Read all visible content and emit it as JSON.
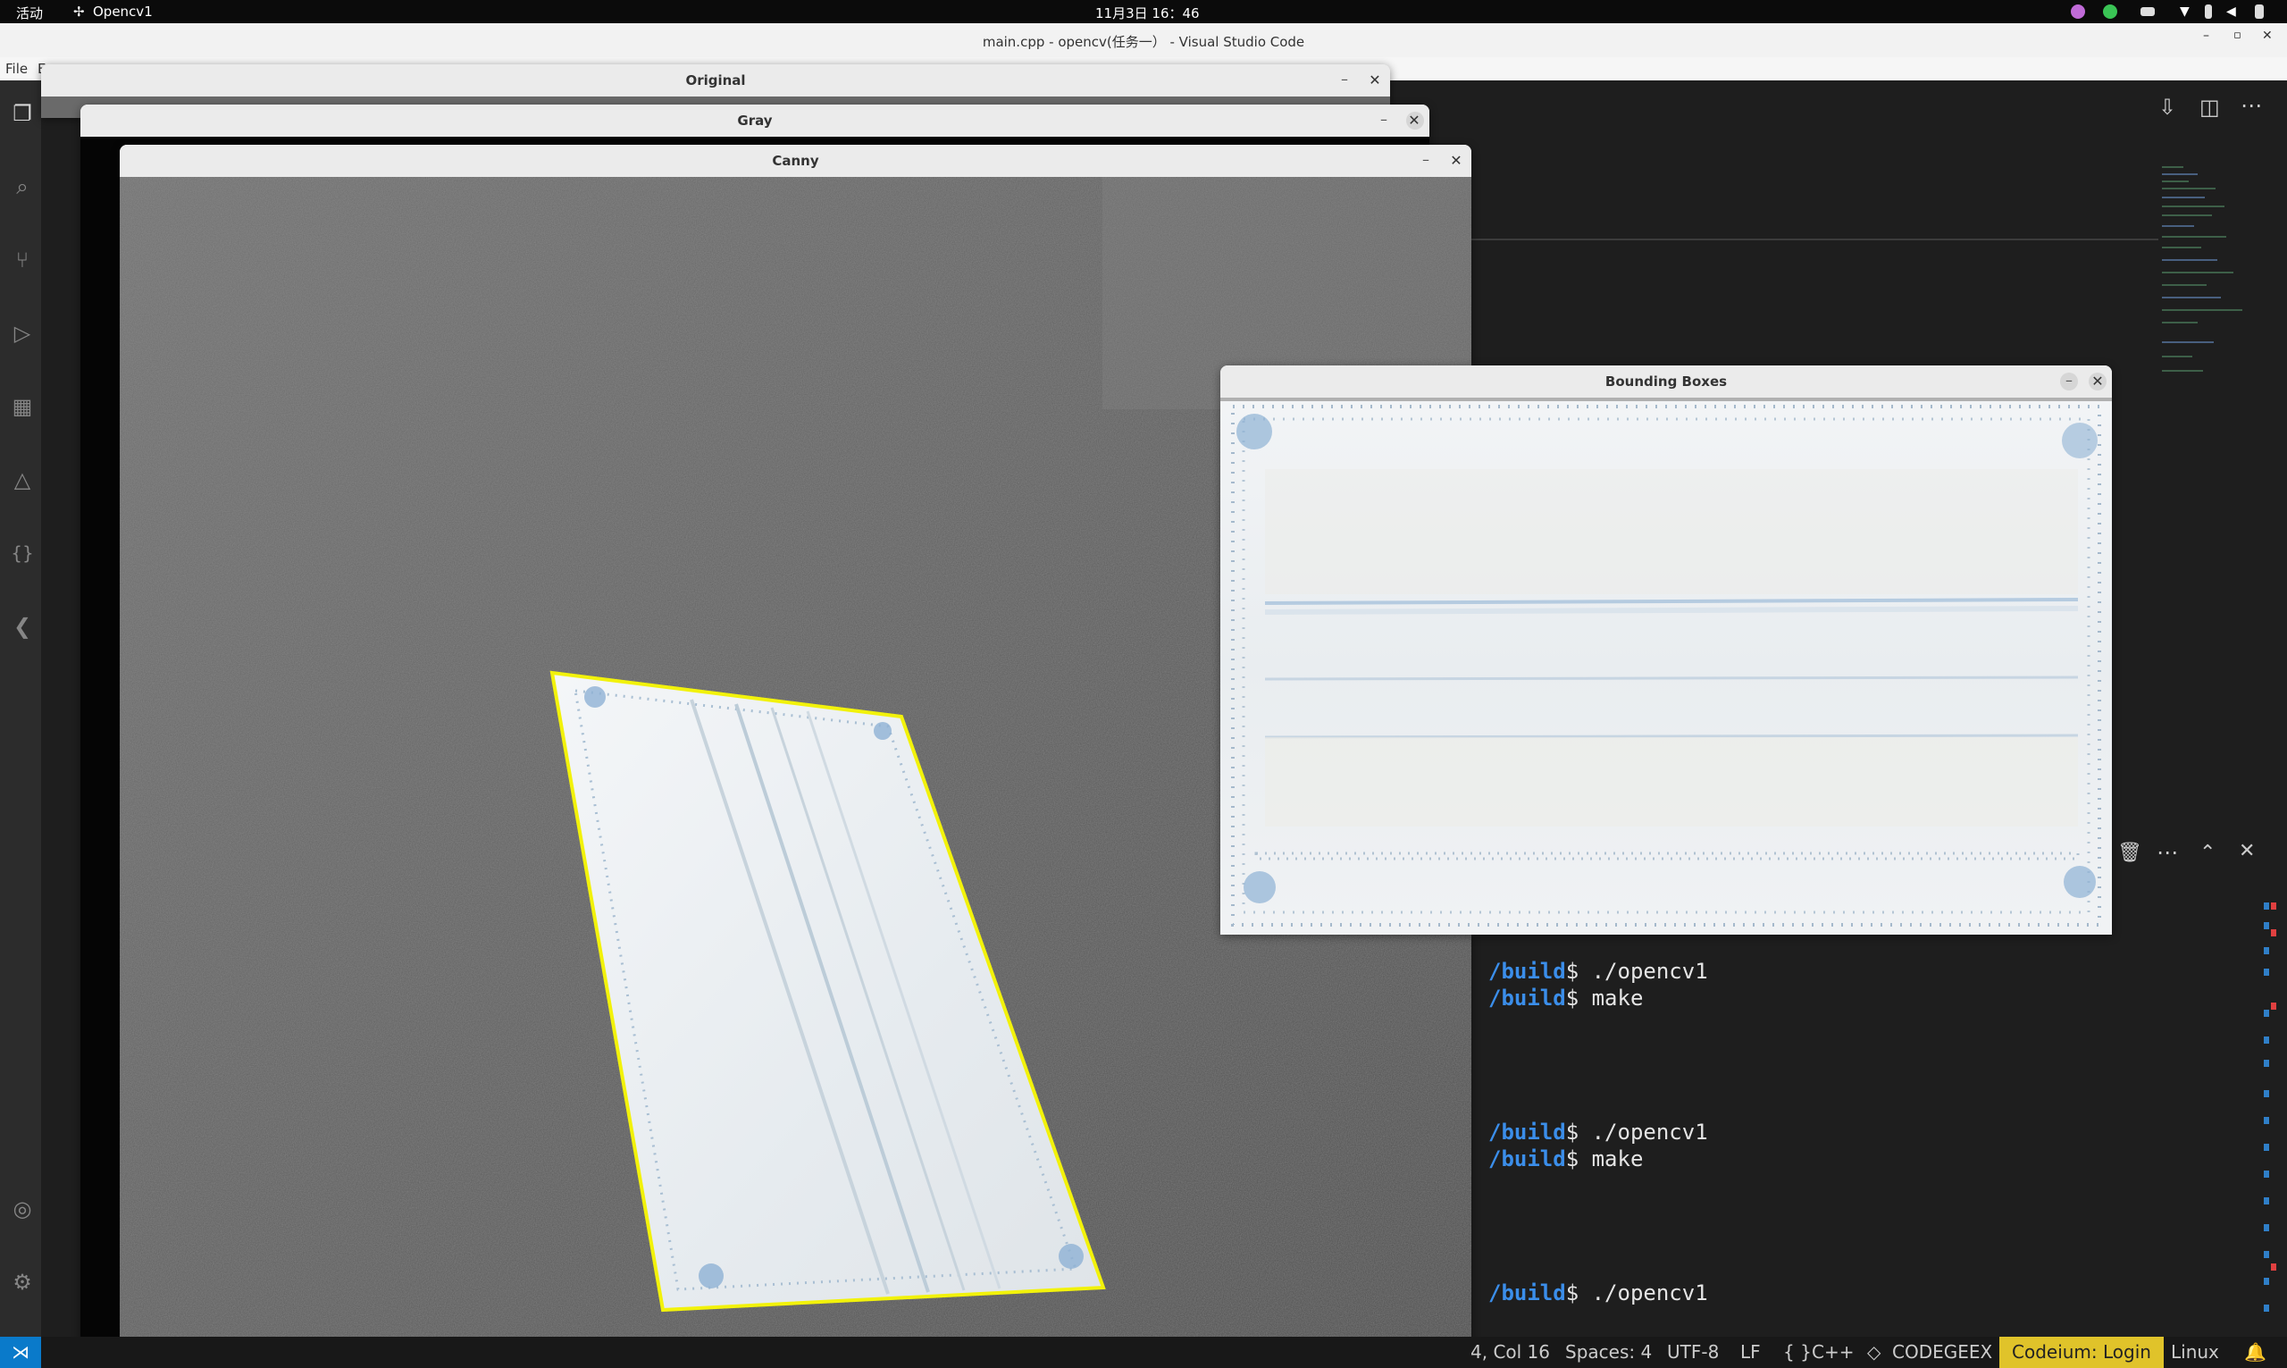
{
  "topbar": {
    "activities": "活动",
    "app_name": "Opencv1",
    "clock": "11月3日 16：46"
  },
  "vscode": {
    "window_title": "main.cpp - opencv(任务一） - Visual Studio Code",
    "menu_file": "File",
    "menu_partial": "E",
    "terminal_lines": [
      {
        "path": "/build",
        "cmd": "$ ./opencv1"
      },
      {
        "path": "/build",
        "cmd": "$ make"
      },
      {
        "path": "/build",
        "cmd": "$ ./opencv1"
      },
      {
        "path": "/build",
        "cmd": "$ make"
      },
      {
        "path": "/build",
        "cmd": "$ ./opencv1"
      }
    ]
  },
  "statusbar": {
    "cursor": "4, Col 16",
    "spaces": "Spaces: 4",
    "encoding": "UTF-8",
    "eol": "LF",
    "language_icon": "{ }",
    "language": "C++",
    "codegeex": "CODEGEEX",
    "codeium": "Codeium: Login",
    "os": "Linux"
  },
  "windows": {
    "original": {
      "title": "Original"
    },
    "gray": {
      "title": "Gray"
    },
    "canny": {
      "title": "Canny"
    },
    "bounding": {
      "title": "Bounding Boxes"
    }
  },
  "icons": {
    "minimize": "–",
    "close": "✕"
  },
  "colors": {
    "contour": "#ffff00",
    "asphalt": "#5a5a5a",
    "mask_fill": "#eef1f3",
    "mask_blue": "#8fb2d4",
    "codeium_badge": "#e0c32a",
    "remote_badge": "#0a7aca"
  }
}
